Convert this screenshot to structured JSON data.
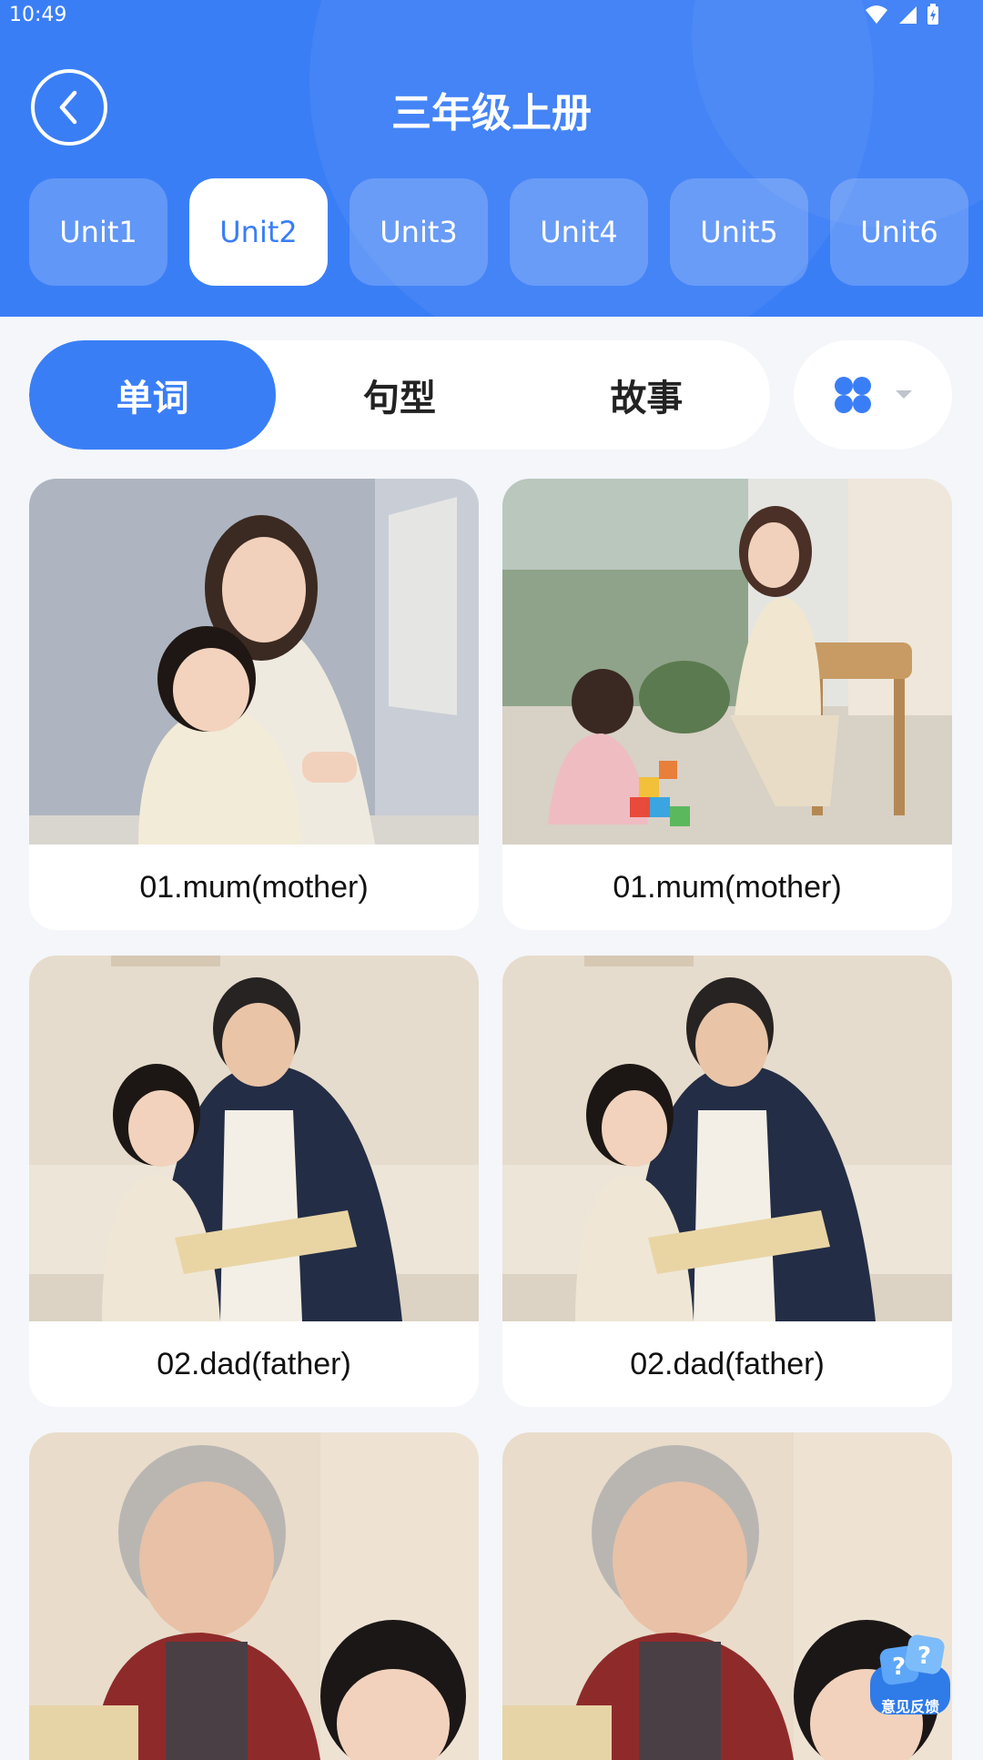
{
  "status_bar": {
    "time": "10:49"
  },
  "header": {
    "title": "三年级上册"
  },
  "units": [
    {
      "label": "Unit1",
      "active": false
    },
    {
      "label": "Unit2",
      "active": true
    },
    {
      "label": "Unit3",
      "active": false
    },
    {
      "label": "Unit4",
      "active": false
    },
    {
      "label": "Unit5",
      "active": false
    },
    {
      "label": "Unit6",
      "active": false
    }
  ],
  "segments": [
    {
      "label": "单词",
      "active": true
    },
    {
      "label": "句型",
      "active": false
    },
    {
      "label": "故事",
      "active": false
    }
  ],
  "cards": [
    {
      "caption": "01.mum(mother)",
      "image": "mother-hugging-child"
    },
    {
      "caption": "01.mum(mother)",
      "image": "mother-watching-child-play"
    },
    {
      "caption": "02.dad(father)",
      "image": "father-reading-with-daughter"
    },
    {
      "caption": "02.dad(father)",
      "image": "father-reading-with-daughter"
    },
    {
      "caption": "",
      "image": "grandmother-with-grandson"
    },
    {
      "caption": "",
      "image": "grandmother-with-grandson"
    }
  ],
  "feedback": {
    "label": "意见反馈"
  },
  "colors": {
    "accent": "#3a7ef6",
    "background": "#f4f6fa"
  }
}
